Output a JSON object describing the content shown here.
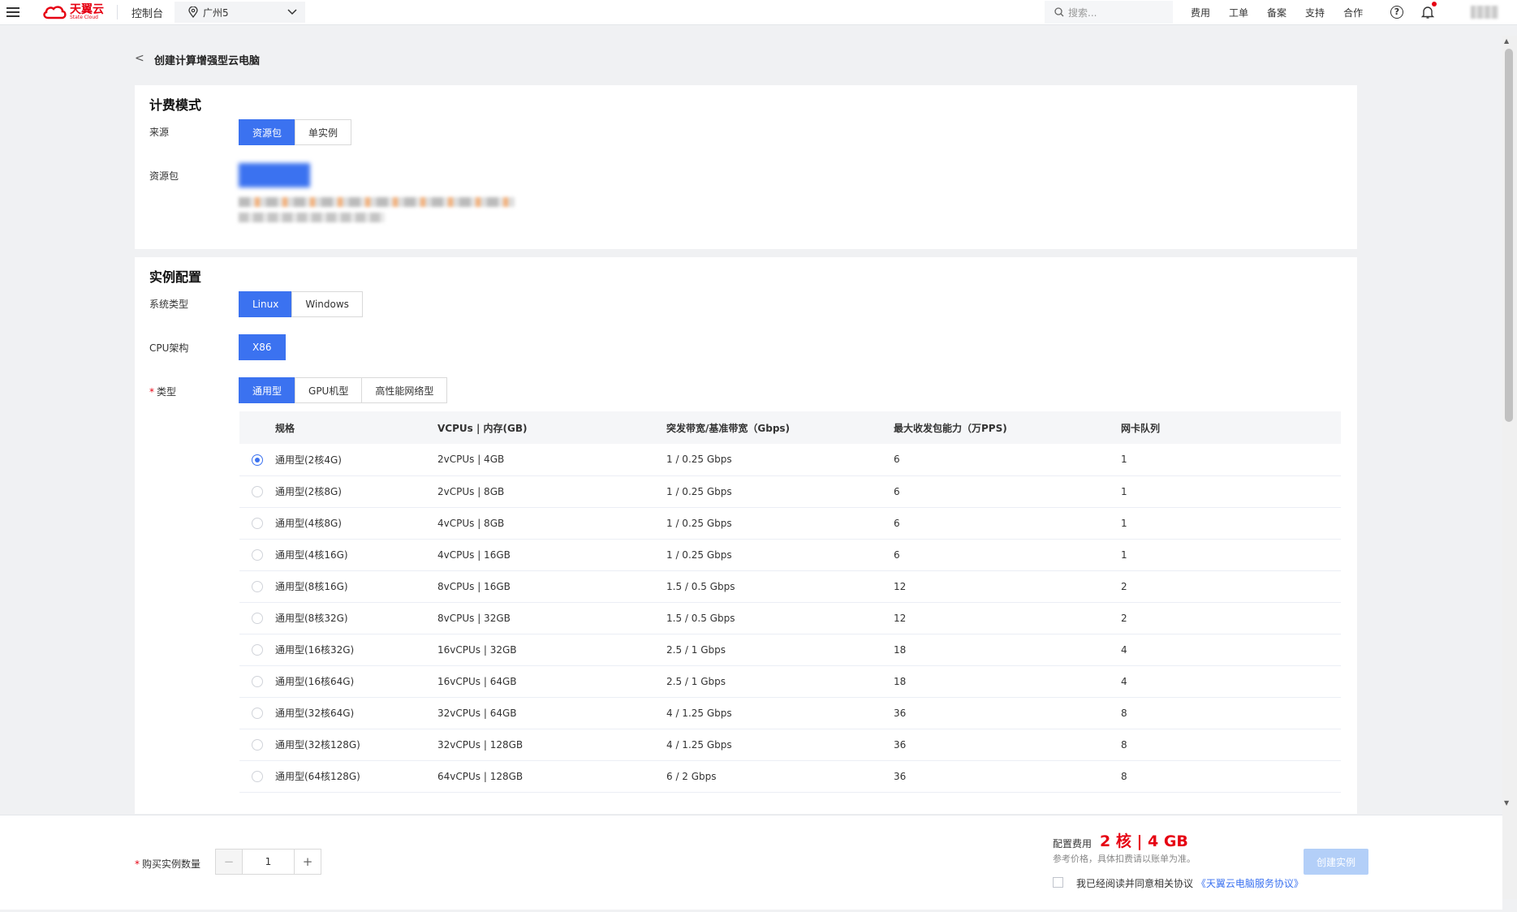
{
  "topbar": {
    "logo_cn": "天翼云",
    "logo_en": "State Cloud",
    "console": "控制台",
    "region": "广州5",
    "search_placeholder": "搜索...",
    "links": [
      "费用",
      "工单",
      "备案",
      "支持",
      "合作"
    ],
    "help": "?"
  },
  "breadcrumb": {
    "back": "<",
    "title": "创建计算增强型云电脑"
  },
  "billing": {
    "title": "计费模式",
    "source_label": "来源",
    "source_options": [
      "资源包",
      "单实例"
    ],
    "source_selected": "资源包",
    "package_label": "资源包"
  },
  "instance": {
    "title": "实例配置",
    "os_label": "系统类型",
    "os_options": [
      "Linux",
      "Windows"
    ],
    "os_selected": "Linux",
    "cpu_label": "CPU架构",
    "cpu_options": [
      "X86"
    ],
    "cpu_selected": "X86",
    "type_label": "类型",
    "type_required": "*",
    "type_options": [
      "通用型",
      "GPU机型",
      "高性能网络型"
    ],
    "type_selected": "通用型",
    "table": {
      "headers": [
        "规格",
        "VCPUs | 内存(GB)",
        "突发带宽/基准带宽（Gbps)",
        "最大收发包能力（万PPS)",
        "网卡队列"
      ],
      "selected_index": 0,
      "rows": [
        [
          "通用型(2核4G)",
          "2vCPUs | 4GB",
          "1 / 0.25 Gbps",
          "6",
          "1"
        ],
        [
          "通用型(2核8G)",
          "2vCPUs | 8GB",
          "1 / 0.25 Gbps",
          "6",
          "1"
        ],
        [
          "通用型(4核8G)",
          "4vCPUs | 8GB",
          "1 / 0.25 Gbps",
          "6",
          "1"
        ],
        [
          "通用型(4核16G)",
          "4vCPUs | 16GB",
          "1 / 0.25 Gbps",
          "6",
          "1"
        ],
        [
          "通用型(8核16G)",
          "8vCPUs | 16GB",
          "1.5 / 0.5 Gbps",
          "12",
          "2"
        ],
        [
          "通用型(8核32G)",
          "8vCPUs | 32GB",
          "1.5 / 0.5 Gbps",
          "12",
          "2"
        ],
        [
          "通用型(16核32G)",
          "16vCPUs | 32GB",
          "2.5 / 1 Gbps",
          "18",
          "4"
        ],
        [
          "通用型(16核64G)",
          "16vCPUs | 64GB",
          "2.5 / 1 Gbps",
          "18",
          "4"
        ],
        [
          "通用型(32核64G)",
          "32vCPUs | 64GB",
          "4 / 1.25 Gbps",
          "36",
          "8"
        ],
        [
          "通用型(32核128G)",
          "32vCPUs | 128GB",
          "4 / 1.25 Gbps",
          "36",
          "8"
        ],
        [
          "通用型(64核128G)",
          "64vCPUs | 128GB",
          "6 / 2 Gbps",
          "36",
          "8"
        ]
      ]
    }
  },
  "footer": {
    "qty_required": "*",
    "qty_label": "购买实例数量",
    "qty_minus": "−",
    "qty_value": "1",
    "qty_plus": "+",
    "cost_label": "配置费用",
    "cost_value": "2 核 | 4 GB",
    "cost_note": "参考价格，具体扣费请以账单为准。",
    "create_button": "创建实例",
    "agree_text": "我已经阅读并同意相关协议",
    "agree_link": "《天翼云电脑服务协议》"
  },
  "colors": {
    "accent": "#3b72f0",
    "brand": "#e60012",
    "disabled_button": "#b3cff8"
  }
}
